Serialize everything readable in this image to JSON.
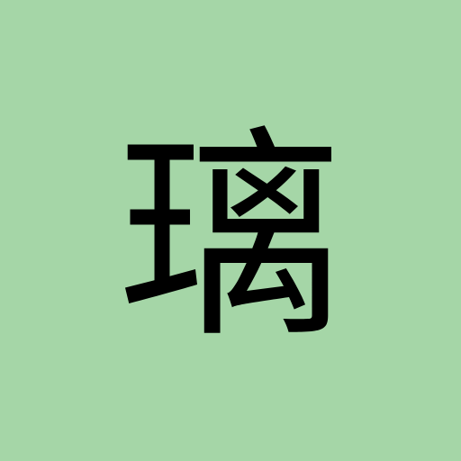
{
  "card": {
    "character": "璃",
    "background_color": "#a5d6a7",
    "text_color": "#000000"
  }
}
